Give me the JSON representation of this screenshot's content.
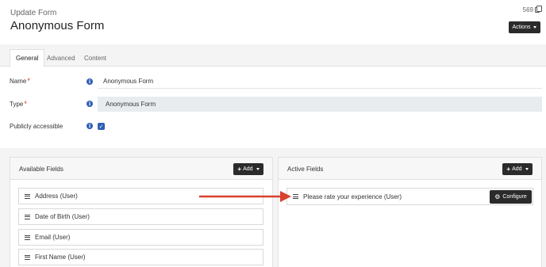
{
  "header": {
    "subtitle": "Update Form",
    "title": "Anonymous Form",
    "count": "569",
    "count_icon": "copy-icon",
    "actions_label": "Actions"
  },
  "tabs": [
    {
      "label": "General",
      "active": true
    },
    {
      "label": "Advanced",
      "active": false
    },
    {
      "label": "Content",
      "active": false
    }
  ],
  "form": {
    "name_label": "Name",
    "name_required": "*",
    "name_value": "Anonymous Form",
    "type_label": "Type",
    "type_required": "*",
    "type_value": "Anonymous Form",
    "public_label": "Publicly accessible",
    "public_checked": true,
    "info_icon": "i"
  },
  "available": {
    "title": "Available Fields",
    "add_label": "Add",
    "items": [
      "Address (User)",
      "Date of Birth (User)",
      "Email (User)",
      "First Name (User)"
    ]
  },
  "active": {
    "title": "Active Fields",
    "add_label": "Add",
    "items": [
      "Please rate your experience (User)"
    ],
    "configure_label": "Configure"
  },
  "colors": {
    "primary": "#2f5fb3",
    "dark_button": "#2b2b2b",
    "required": "#d9302a",
    "arrow": "#d9402e"
  }
}
